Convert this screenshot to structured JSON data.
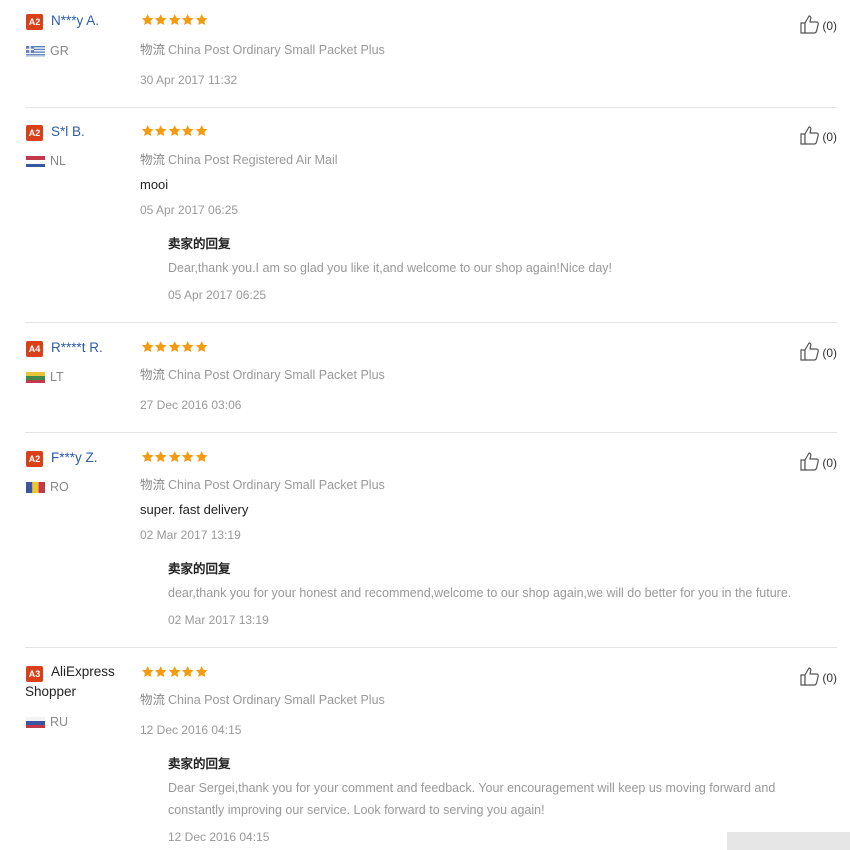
{
  "reviews": [
    {
      "level": "A2",
      "name": "N***y A.",
      "country": "GR",
      "flag": "gr",
      "stars": 5,
      "logistics_prefix": "物流",
      "logistics": "China Post Ordinary Small Packet Plus",
      "comment": "",
      "date": "30 Apr 2017 11:32",
      "helpful": "(0)",
      "reply": null
    },
    {
      "level": "A2",
      "name": "S*l B.",
      "country": "NL",
      "flag": "nl",
      "stars": 5,
      "logistics_prefix": "物流",
      "logistics": "China Post Registered Air Mail",
      "comment": "mooi",
      "date": "05 Apr 2017 06:25",
      "helpful": "(0)",
      "reply": {
        "title": "卖家的回复",
        "text": "Dear,thank you.I am so glad you like it,and welcome to our shop again!Nice day!",
        "date": "05 Apr 2017 06:25"
      }
    },
    {
      "level": "A4",
      "name": "R****t R.",
      "country": "LT",
      "flag": "lt",
      "stars": 5,
      "logistics_prefix": "物流",
      "logistics": "China Post Ordinary Small Packet Plus",
      "comment": "",
      "date": "27 Dec 2016 03:06",
      "helpful": "(0)",
      "reply": null
    },
    {
      "level": "A2",
      "name": "F***y Z.",
      "country": "RO",
      "flag": "ro",
      "stars": 5,
      "logistics_prefix": "物流",
      "logistics": "China Post Ordinary Small Packet Plus",
      "comment": "super. fast delivery",
      "date": "02 Mar 2017 13:19",
      "helpful": "(0)",
      "reply": {
        "title": "卖家的回复",
        "text": "dear,thank you for your honest and recommend,welcome to our shop again,we will do better for you in the future.",
        "date": "02 Mar 2017 13:19"
      }
    },
    {
      "level": "A3",
      "name": "AliExpress Shopper",
      "country": "RU",
      "flag": "ru",
      "stars": 5,
      "logistics_prefix": "物流",
      "logistics": "China Post Ordinary Small Packet Plus",
      "comment": "",
      "date": "12 Dec 2016 04:15",
      "helpful": "(0)",
      "reply": {
        "title": "卖家的回复",
        "text": "Dear Sergei,thank you for your comment and feedback. Your encouragement will keep us moving forward and constantly improving our service. Look forward to serving you again!",
        "date": "12 Dec 2016 04:15"
      }
    }
  ],
  "colors": {
    "star": "#f39c12",
    "badge": "#d9401a",
    "name": "#2d5ca8"
  },
  "icons": {
    "star": "star-icon",
    "helpful": "thumbs-up-icon"
  }
}
